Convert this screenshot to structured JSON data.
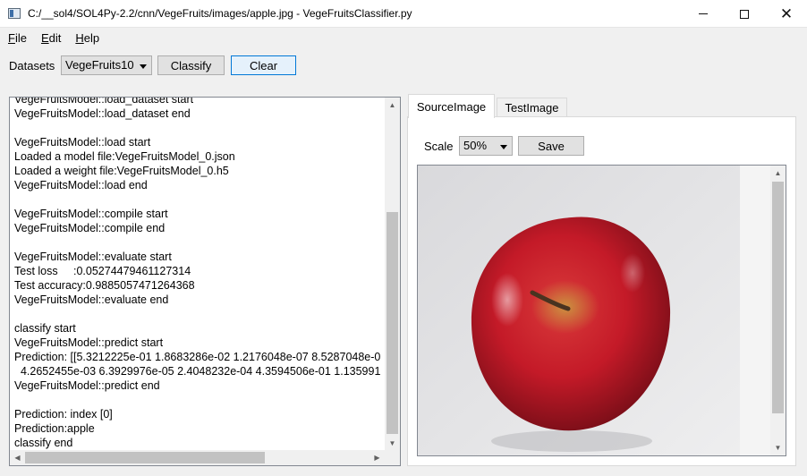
{
  "window": {
    "title": "C:/__sol4/SOL4Py-2.2/cnn/VegeFruits/images/apple.jpg - VegeFruitsClassifier.py",
    "minimize_icon": "minimize-icon",
    "maximize_icon": "maximize-icon",
    "close_icon": "close-icon"
  },
  "menu": {
    "items": [
      {
        "mnemonic": "F",
        "rest": "ile"
      },
      {
        "mnemonic": "E",
        "rest": "dit"
      },
      {
        "mnemonic": "H",
        "rest": "elp"
      }
    ]
  },
  "toolbar": {
    "datasets_label": "Datasets",
    "datasets_value": "VegeFruits10",
    "classify_label": "Classify",
    "clear_label": "Clear"
  },
  "log": {
    "lines": [
      "VegeFruitsModel::load_dataset start",
      "VegeFruitsModel::load_dataset end",
      "",
      "VegeFruitsModel::load start",
      "Loaded a model file:VegeFruitsModel_0.json",
      "Loaded a weight file:VegeFruitsModel_0.h5",
      "VegeFruitsModel::load end",
      "",
      "VegeFruitsModel::compile start",
      "VegeFruitsModel::compile end",
      "",
      "VegeFruitsModel::evaluate start",
      "Test loss     :0.05274479461127314",
      "Test accuracy:0.9885057471264368",
      "VegeFruitsModel::evaluate end",
      "",
      "classify start",
      "VegeFruitsModel::predict start",
      "Prediction: [[5.3212225e-01 1.8683286e-02 1.2176048e-07 8.5287048e-0",
      "  4.2652455e-03 6.3929976e-05 2.4048232e-04 4.3594506e-01 1.135991",
      "VegeFruitsModel::predict end",
      "",
      "Prediction: index [0]",
      "Prediction:apple",
      "classify end"
    ]
  },
  "tabs": [
    {
      "label": "SourceImage",
      "selected": true
    },
    {
      "label": "TestImage",
      "selected": false
    }
  ],
  "image_panel": {
    "scale_label": "Scale",
    "scale_value": "50%",
    "save_label": "Save",
    "image_subject": "apple"
  },
  "colors": {
    "accent": "#0078d7",
    "apple_red": "#c4182a"
  }
}
